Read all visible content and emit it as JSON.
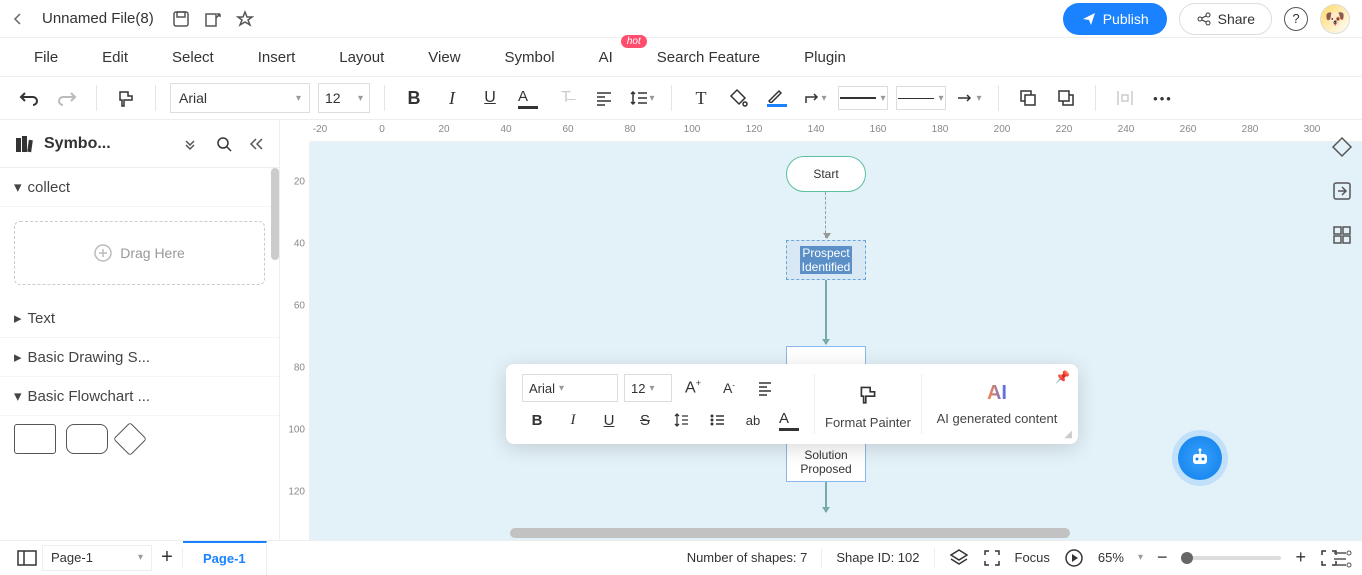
{
  "titlebar": {
    "filename": "Unnamed File(8)",
    "publish_label": "Publish",
    "share_label": "Share"
  },
  "menubar": {
    "items": [
      "File",
      "Edit",
      "Select",
      "Insert",
      "Layout",
      "View",
      "Symbol",
      "AI",
      "Search Feature",
      "Plugin"
    ],
    "hot_badge": "hot"
  },
  "toolbar": {
    "font": "Arial",
    "font_size": "12"
  },
  "sidebar": {
    "title": "Symbo...",
    "sections": {
      "collect": "collect",
      "drag_here": "Drag Here",
      "text": "Text",
      "basic_drawing": "Basic Drawing S...",
      "basic_flowchart": "Basic Flowchart ..."
    }
  },
  "canvas": {
    "hruler_ticks": [
      "-20",
      "0",
      "20",
      "40",
      "60",
      "80",
      "100",
      "120",
      "140",
      "160",
      "180",
      "200",
      "220",
      "240",
      "260",
      "280",
      "300"
    ],
    "vruler_ticks": [
      "20",
      "40",
      "60",
      "80",
      "100",
      "120"
    ],
    "nodes": {
      "start": "Start",
      "prospect_l1": "Prospect",
      "prospect_l2": "Identified",
      "solution_l1": "Solution",
      "solution_l2": "Proposed"
    }
  },
  "float_toolbar": {
    "font": "Arial",
    "font_size": "12",
    "format_painter": "Format Painter",
    "ai_label": "AI",
    "ai_caption": "AI generated content"
  },
  "statusbar": {
    "page_selector": "Page-1",
    "active_tab": "Page-1",
    "shape_count": "Number of shapes: 7",
    "shape_id": "Shape ID: 102",
    "focus_label": "Focus",
    "zoom": "65%"
  }
}
